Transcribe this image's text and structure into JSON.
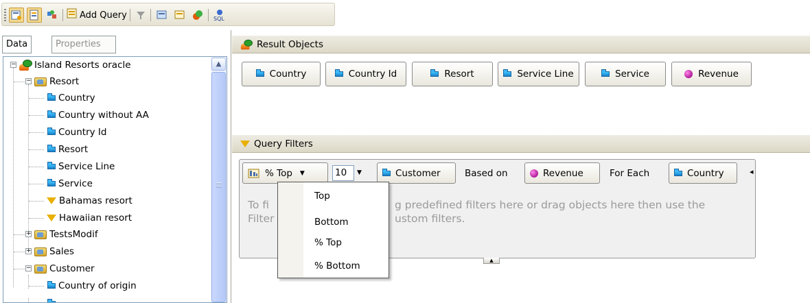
{
  "toolbar": {
    "add_query_label": "Add Query",
    "icons": [
      "query-panel-icon",
      "document-icon",
      "properties-icon",
      "add-query-icon",
      "filter-icon",
      "filter-pane-icon",
      "combine-icon",
      "data-provider-icon",
      "sql-icon"
    ]
  },
  "left_panel": {
    "tabs": [
      "Data",
      "Properties"
    ],
    "tree": {
      "root": "Island Resorts oracle",
      "items": [
        {
          "label": "Resort",
          "type": "folder"
        },
        {
          "label": "Country",
          "type": "dimension"
        },
        {
          "label": "Country without AA",
          "type": "dimension"
        },
        {
          "label": "Country Id",
          "type": "dimension"
        },
        {
          "label": "Resort",
          "type": "dimension"
        },
        {
          "label": "Service Line",
          "type": "dimension"
        },
        {
          "label": "Service",
          "type": "dimension"
        },
        {
          "label": "Bahamas resort",
          "type": "filter"
        },
        {
          "label": "Hawaiian resort",
          "type": "filter"
        },
        {
          "label": "TestsModif",
          "type": "folder"
        },
        {
          "label": "Sales",
          "type": "folder"
        },
        {
          "label": "Customer",
          "type": "folder"
        },
        {
          "label": "Country of origin",
          "type": "dimension"
        }
      ]
    }
  },
  "result_objects": {
    "title": "Result Objects",
    "objects": [
      {
        "label": "Country",
        "type": "dimension"
      },
      {
        "label": "Country Id",
        "type": "dimension"
      },
      {
        "label": "Resort",
        "type": "dimension"
      },
      {
        "label": "Service Line",
        "type": "dimension"
      },
      {
        "label": "Service",
        "type": "dimension"
      },
      {
        "label": "Revenue",
        "type": "measure"
      }
    ]
  },
  "query_filters": {
    "title": "Query Filters",
    "rank_operator": "% Top",
    "rank_value": "10",
    "rank_object": "Customer",
    "based_on_label": "Based on",
    "based_on_object": "Revenue",
    "for_each_label": "For Each",
    "for_each_object": "Country",
    "hint": "To filter the query, drag predefined filters here or drag objects here then use the Filter Editor to define custom filters.",
    "hint_visible_left": "To fi",
    "hint_visible_mid": "g predefined filters here or drag objects here then use the",
    "hint_visible_left2": "Filter",
    "hint_visible_mid2": "ustom filters.",
    "dropdown": [
      "Top",
      "Bottom",
      "% Top",
      "% Bottom"
    ]
  },
  "colors": {
    "header_bg": "#e6e3d4",
    "selection": "#f3d990",
    "dimension": "#1a7fc6",
    "measure": "#b0189a",
    "filter": "#e8b000"
  }
}
